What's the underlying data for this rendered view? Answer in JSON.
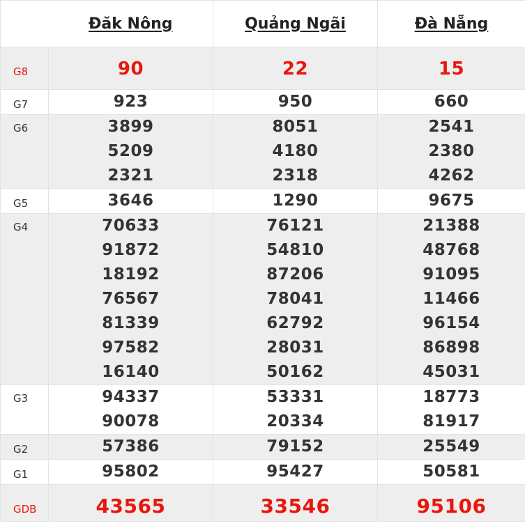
{
  "provinces": [
    "Đăk Nông",
    "Quảng Ngãi",
    "Đà Nẵng"
  ],
  "prizes": [
    {
      "label": "G8",
      "values": [
        [
          "90"
        ],
        [
          "22"
        ],
        [
          "15"
        ]
      ]
    },
    {
      "label": "G7",
      "values": [
        [
          "923"
        ],
        [
          "950"
        ],
        [
          "660"
        ]
      ]
    },
    {
      "label": "G6",
      "values": [
        [
          "3899",
          "5209",
          "2321"
        ],
        [
          "8051",
          "4180",
          "2318"
        ],
        [
          "2541",
          "2380",
          "4262"
        ]
      ]
    },
    {
      "label": "G5",
      "values": [
        [
          "3646"
        ],
        [
          "1290"
        ],
        [
          "9675"
        ]
      ]
    },
    {
      "label": "G4",
      "values": [
        [
          "70633",
          "91872",
          "18192",
          "76567",
          "81339",
          "97582",
          "16140"
        ],
        [
          "76121",
          "54810",
          "87206",
          "78041",
          "62792",
          "28031",
          "50162"
        ],
        [
          "21388",
          "48768",
          "91095",
          "11466",
          "96154",
          "86898",
          "45031"
        ]
      ]
    },
    {
      "label": "G3",
      "values": [
        [
          "94337",
          "90078"
        ],
        [
          "53331",
          "20334"
        ],
        [
          "18773",
          "81917"
        ]
      ]
    },
    {
      "label": "G2",
      "values": [
        [
          "57386"
        ],
        [
          "79152"
        ],
        [
          "25549"
        ]
      ]
    },
    {
      "label": "G1",
      "values": [
        [
          "95802"
        ],
        [
          "95427"
        ],
        [
          "50581"
        ]
      ]
    },
    {
      "label": "GDB",
      "values": [
        [
          "43565"
        ],
        [
          "33546"
        ],
        [
          "95106"
        ]
      ]
    }
  ],
  "colors": {
    "highlight": "#e8160c",
    "text": "#333333",
    "row_alt": "#eeeeee"
  }
}
